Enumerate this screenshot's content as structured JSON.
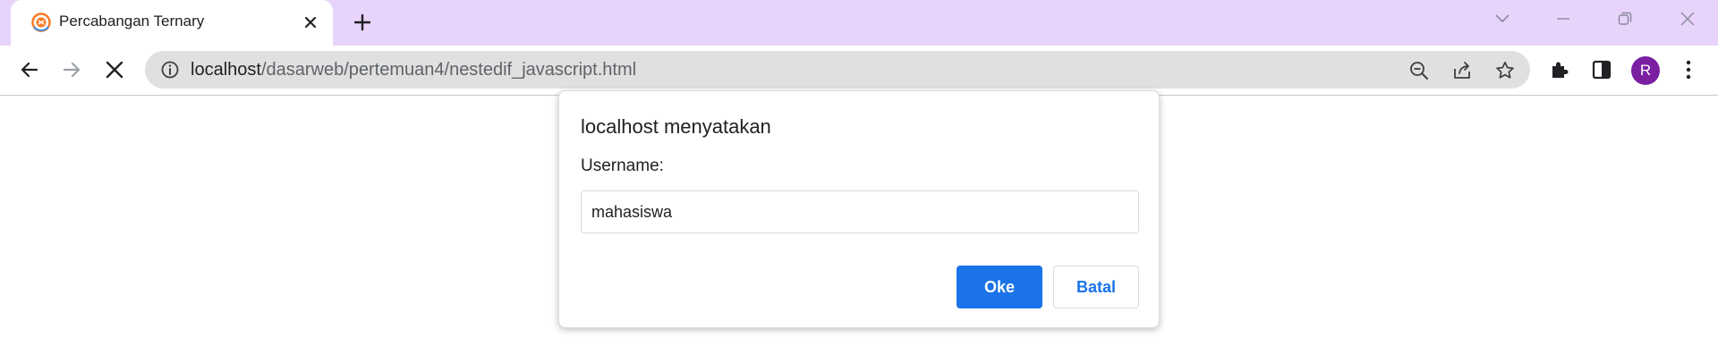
{
  "tab": {
    "title": "Percabangan Ternary",
    "favicon": "xampp-icon"
  },
  "window_controls": [
    "tab-search-icon",
    "minimize-icon",
    "restore-icon",
    "close-icon"
  ],
  "toolbar": {
    "back_icon": "arrow-left-icon",
    "forward_icon": "arrow-right-icon",
    "stop_icon": "stop-loading-icon",
    "profile_initial": "R",
    "profile_color": "#7b1fa2"
  },
  "omnibox": {
    "url_host": "localhost",
    "url_path": "/dasarweb/pertemuan4/nestedif_javascript.html",
    "icons": [
      "zoom-out-icon",
      "share-icon",
      "bookmark-star-icon"
    ]
  },
  "dialog": {
    "title": "localhost menyatakan",
    "message": "Username:",
    "input_value": "mahasiswa",
    "ok_label": "Oke",
    "cancel_label": "Batal",
    "accent": "#1a73e8"
  },
  "colors": {
    "tabstrip": "#e8d3fb",
    "omnibox": "#e0e0e0"
  }
}
